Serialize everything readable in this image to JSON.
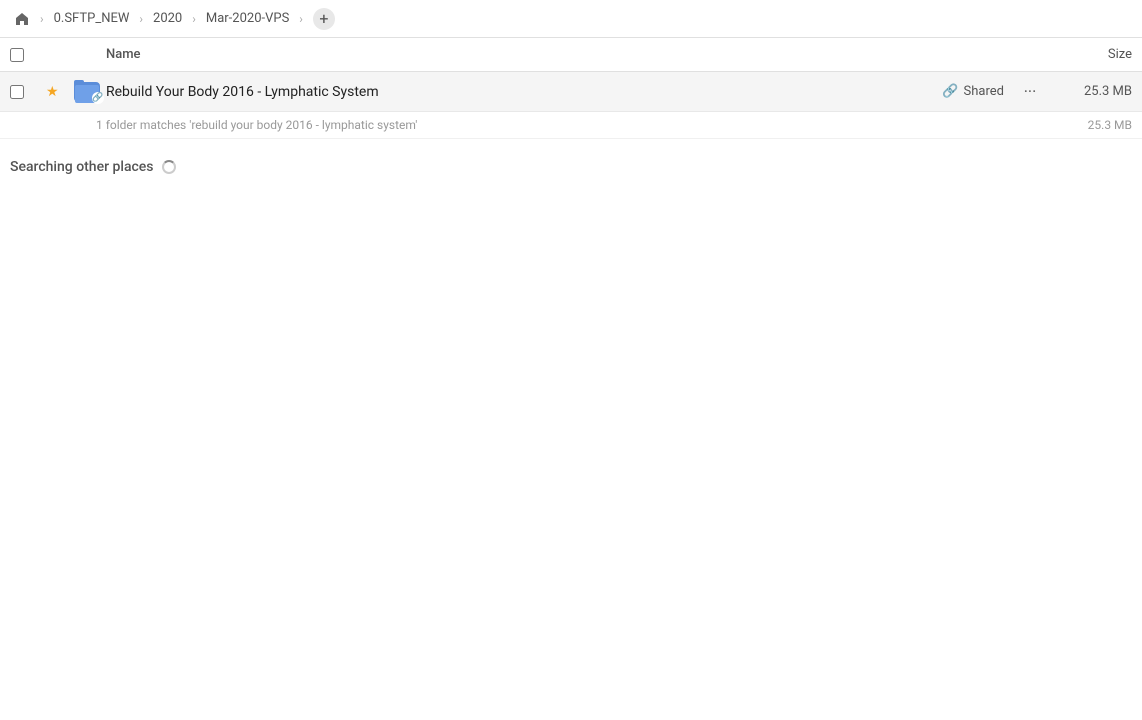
{
  "toolbar": {
    "home_icon": "🏠",
    "breadcrumbs": [
      {
        "label": "0.SFTP_NEW"
      },
      {
        "label": "2020"
      },
      {
        "label": "Mar-2020-VPS"
      }
    ],
    "add_label": "+"
  },
  "columns": {
    "name_label": "Name",
    "size_label": "Size"
  },
  "file_row": {
    "name": "Rebuild Your Body 2016 - Lymphatic System",
    "shared_label": "Shared",
    "size": "25.3 MB",
    "star": "★"
  },
  "match_info": {
    "text": "1 folder matches 'rebuild your body 2016 - lymphatic system'",
    "size": "25.3 MB"
  },
  "searching": {
    "label": "Searching other places"
  }
}
